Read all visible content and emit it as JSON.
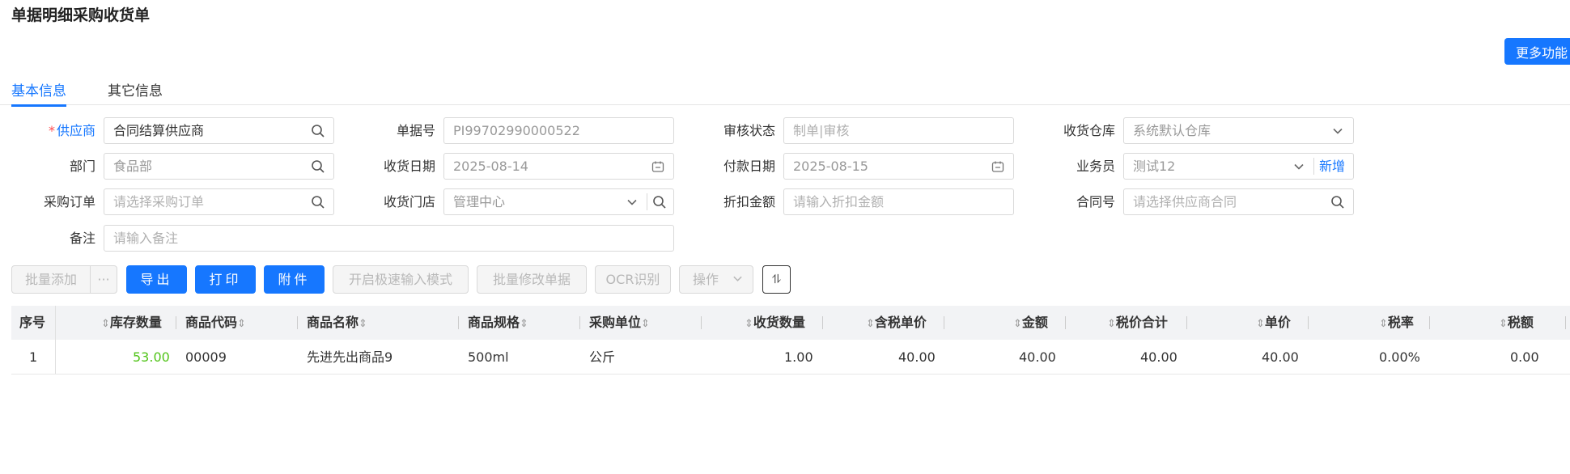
{
  "page": {
    "title": "单据明细采购收货单",
    "more_button": "更多功能"
  },
  "tabs": [
    {
      "label": "基本信息",
      "active": true
    },
    {
      "label": "其它信息",
      "active": false
    }
  ],
  "form": {
    "supplier": {
      "label": "供应商",
      "required_mark": "*",
      "value": "合同结算供应商"
    },
    "doc_no": {
      "label": "单据号",
      "value": "PI99702990000522"
    },
    "audit_status": {
      "label": "审核状态",
      "placeholder": "制单|审核"
    },
    "warehouse": {
      "label": "收货仓库",
      "value": "系统默认仓库"
    },
    "department": {
      "label": "部门",
      "value": "食品部"
    },
    "receive_date": {
      "label": "收货日期",
      "value": "2025-08-14"
    },
    "pay_date": {
      "label": "付款日期",
      "value": "2025-08-15"
    },
    "salesman": {
      "label": "业务员",
      "value": "测试12",
      "add_link": "新增"
    },
    "purchase_order": {
      "label": "采购订单",
      "placeholder": "请选择采购订单"
    },
    "store": {
      "label": "收货门店",
      "value": "管理中心"
    },
    "discount": {
      "label": "折扣金额",
      "placeholder": "请输入折扣金额"
    },
    "contract": {
      "label": "合同号",
      "placeholder": "请选择供应商合同"
    },
    "remark": {
      "label": "备注",
      "placeholder": "请输入备注"
    }
  },
  "toolbar": {
    "batch_add": "批量添加",
    "more_dots": "···",
    "export": "导出",
    "print": "打印",
    "attach": "附件",
    "fast_input": "开启极速输入模式",
    "batch_modify": "批量修改单据",
    "ocr": "OCR识别",
    "operate": "操作",
    "column_toggle": "⥮"
  },
  "table": {
    "headers": [
      "序号",
      "库存数量",
      "商品代码",
      "商品名称",
      "商品规格",
      "采购单位",
      "收货数量",
      "含税单价",
      "金额",
      "税价合计",
      "单价",
      "税率",
      "税额"
    ],
    "rows": [
      [
        "1",
        "53.00",
        "00009",
        "先进先出商品9",
        "500ml",
        "公斤",
        "1.00",
        "40.00",
        "40.00",
        "40.00",
        "40.00",
        "0.00%",
        "0.00"
      ]
    ]
  },
  "colors": {
    "accent": "#1677ff",
    "stock_green": "#52c41a",
    "required_red": "#ff4d4f"
  }
}
